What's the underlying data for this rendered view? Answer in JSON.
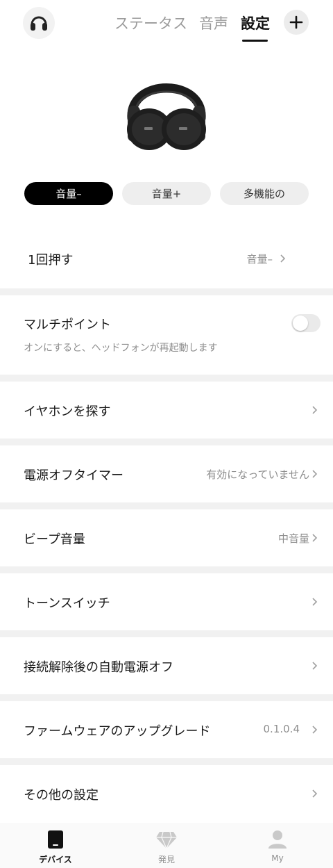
{
  "header": {
    "tabs": [
      {
        "label": "ステータス"
      },
      {
        "label": "音声"
      },
      {
        "label": "設定"
      }
    ],
    "avatar_icon": "headphones-icon",
    "add_icon": "plus-icon"
  },
  "product": {
    "icon": "headphones-product-image"
  },
  "button_selector": {
    "options": [
      {
        "label": "音量–"
      },
      {
        "label": "音量+"
      },
      {
        "label": "多機能の"
      }
    ],
    "selected": "音量–"
  },
  "press_action": {
    "title": "1回押す",
    "value": "音量–"
  },
  "multipoint": {
    "title": "マルチポイント",
    "description": "オンにすると、ヘッドフォンが再起動します",
    "enabled": false
  },
  "settings": [
    {
      "title": "イヤホンを探す",
      "value": ""
    },
    {
      "title": "電源オフタイマー",
      "value": "有効になっていません"
    },
    {
      "title": "ビープ音量",
      "value": "中音量"
    },
    {
      "title": "トーンスイッチ",
      "value": ""
    },
    {
      "title": "接続解除後の自動電源オフ",
      "value": ""
    },
    {
      "title": "ファームウェアのアップグレード",
      "value": "0.1.0.4"
    },
    {
      "title": "その他の設定",
      "value": ""
    }
  ],
  "bottom_nav": {
    "items": [
      {
        "label": "デバイス",
        "icon": "device-icon"
      },
      {
        "label": "発見",
        "icon": "diamond-icon"
      },
      {
        "label": "My",
        "icon": "profile-icon"
      }
    ],
    "active": "デバイス"
  },
  "colors": {
    "accent": "#000000",
    "secondary_text": "#8e8e8e",
    "divider": "#f1f1f1",
    "pill_bg": "#eeeeee"
  }
}
